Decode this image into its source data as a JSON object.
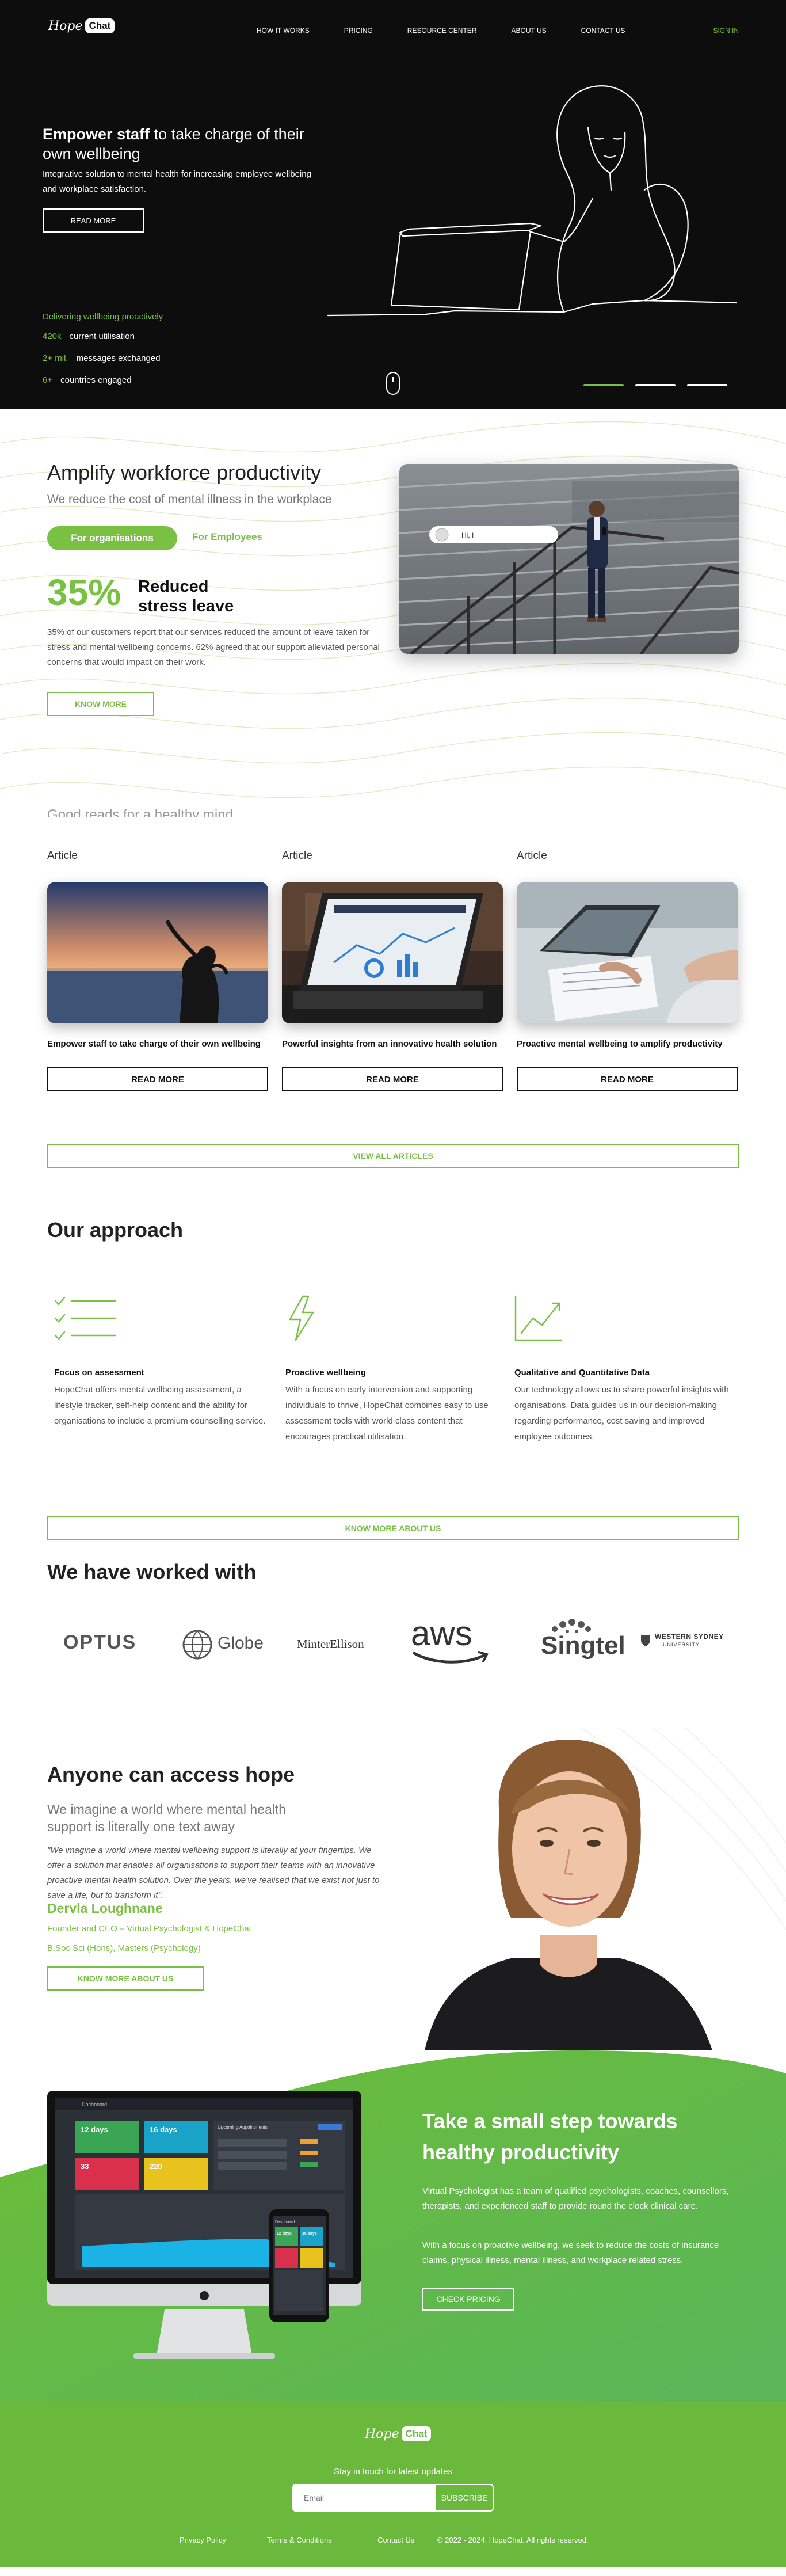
{
  "nav": {
    "logo_hope": "Hope",
    "logo_chat": "Chat",
    "links": [
      "HOW IT WORKS",
      "PRICING",
      "RESOURCE CENTER",
      "ABOUT US",
      "CONTACT US"
    ],
    "sign_in": "SIGN IN"
  },
  "hero": {
    "title_bold": "Empower staff",
    "title_rest": " to take charge of their own wellbeing",
    "subtitle": "Integrative solution to mental health for increasing employee wellbeing and workplace satisfaction.",
    "read_more": "READ MORE",
    "stats_heading": "Delivering wellbeing proactively",
    "stats": [
      {
        "value": "420k",
        "label": "current utilisation"
      },
      {
        "value": "2+ mil.",
        "label": "messages exchanged"
      },
      {
        "value": "6+",
        "label": "countries engaged"
      }
    ]
  },
  "amplify": {
    "title": "Amplify workforce productivity",
    "subtitle": "We reduce the cost of mental illness in the workplace",
    "tab_organisations": "For organisations",
    "tab_employees": "For Employees",
    "percent": "35%",
    "percent_label_1": "Reduced",
    "percent_label_2": "stress leave",
    "body": "35% of our customers report that our services reduced the amount of leave taken for stress and mental wellbeing concerns. 62% agreed that our support alleviated personal concerns that would impact on their work.",
    "know_more": "KNOW MORE",
    "chat_bubble": "Hi, I"
  },
  "articles": {
    "heading_cut": "Good reads for a healthy mind",
    "items": [
      {
        "tag": "Article",
        "title": "Empower staff to take charge of their own wellbeing",
        "button": "READ MORE"
      },
      {
        "tag": "Article",
        "title": "Powerful insights from an innovative health solution",
        "button": "READ MORE"
      },
      {
        "tag": "Article",
        "title": "Proactive mental wellbeing to amplify productivity",
        "button": "READ MORE"
      }
    ],
    "view_all": "VIEW ALL ARTICLES"
  },
  "approach": {
    "title": "Our approach",
    "items": [
      {
        "icon": "checklist-icon",
        "heading": "Focus on assessment",
        "body": "HopeChat offers mental wellbeing assessment, a lifestyle tracker, self-help content and the ability for organisations to include a premium counselling service."
      },
      {
        "icon": "lightning-icon",
        "heading": "Proactive wellbeing",
        "body": "With a focus on early intervention and supporting individuals to thrive, HopeChat combines easy to use assessment tools with world class content that encourages practical utilisation."
      },
      {
        "icon": "line-chart-icon",
        "heading": "Qualitative and Quantitative Data",
        "body": "Our technology allows us to share powerful insights with organisations. Data guides us in our decision-making regarding performance, cost saving and improved employee outcomes."
      }
    ],
    "know_more_about": "KNOW MORE ABOUT US"
  },
  "worked_with": {
    "title": "We have worked with",
    "logos": [
      "OPTUS",
      "Globe",
      "MinterEllison",
      "aws",
      "Singtel",
      "WESTERN SYDNEY",
      "UNIVERSITY"
    ]
  },
  "hope": {
    "title": "Anyone can access hope",
    "subtitle": "We imagine a world where mental health support is literally one text away",
    "quote": "\"We imagine a world where mental wellbeing support is literally at your fingertips. We offer a solution that enables all organisations to support their teams with an innovative proactive mental health solution. Over the years, we've realised that we exist not just to save a life, but to transform it\".",
    "name": "Dervla Loughnane",
    "role": "Founder and CEO – Virtual Psychologist & HopeChat",
    "qualification": "B.Soc Sci (Hons), Masters (Psychology)",
    "know_more_about": "KNOW MORE ABOUT US"
  },
  "dashboard": {
    "title": "Dashboard",
    "tile1_value": "12 days",
    "tile2_value": "16 days",
    "tile3_value": "33",
    "tile4_value": "220",
    "panel_title": "Upcoming Appointments",
    "phone_title": "Dashboard",
    "phone_value": "12 days",
    "phone_value2": "16 days"
  },
  "green": {
    "title": "Take a small step towards healthy productivity",
    "p1": "Virtual Psychologist has a team of qualified psychologists, coaches, counsellors, therapists, and experienced staff to provide round the clock clinical care.",
    "p2": "With a focus on proactive wellbeing, we seek to reduce the costs of insurance claims, physical illness, mental illness, and workplace related stress.",
    "check_pricing": "CHECK PRICING"
  },
  "footer": {
    "logo_hope": "Hope",
    "logo_chat": "Chat",
    "stay": "Stay in touch for latest updates",
    "email_placeholder": "Email",
    "subscribe": "SUBSCRIBE",
    "links": [
      "Privacy Policy",
      "Terms & Conditions",
      "Contact Us"
    ],
    "copyright": "© 2022 - 2024, HopeChat. All rights reserved."
  },
  "colors": {
    "accent": "#7ac143",
    "dark": "#0d0d0d",
    "footer": "#6ab83c"
  }
}
